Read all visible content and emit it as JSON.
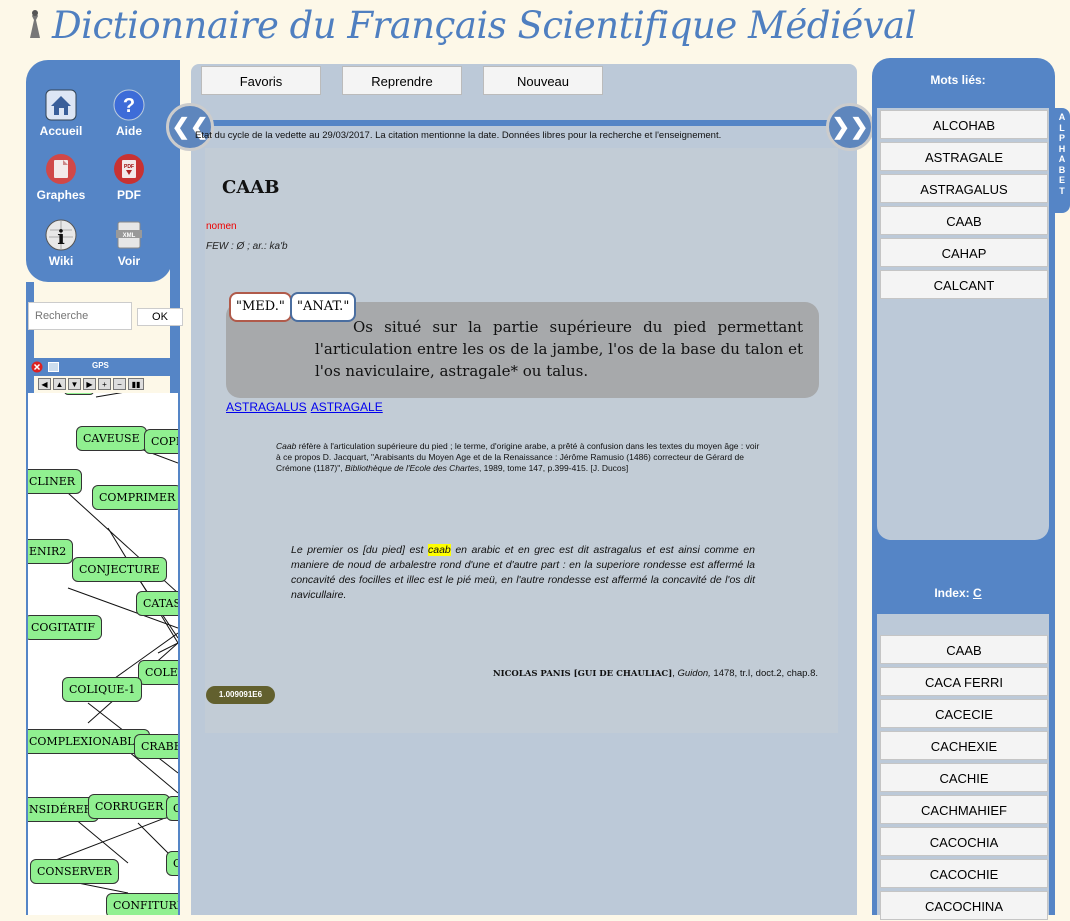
{
  "site": {
    "title": "Dictionnaire du Français Scientifique Médiéval"
  },
  "menu": [
    {
      "label": "Accueil",
      "icon": "home-icon"
    },
    {
      "label": "Aide",
      "icon": "help-icon"
    },
    {
      "label": "Graphes",
      "icon": "graph-icon"
    },
    {
      "label": "PDF",
      "icon": "pdf-icon"
    },
    {
      "label": "Wiki",
      "icon": "wiki-icon"
    },
    {
      "label": "Voir",
      "icon": "xml-icon"
    }
  ],
  "search": {
    "placeholder": "Recherche",
    "ok_label": "OK"
  },
  "gps": {
    "title": "GPS",
    "nodes": [
      "CAVEUSE",
      "COPIE",
      "CLINER",
      "COMPRIMER",
      "ENIR2",
      "CONJECTURE",
      "CATAST",
      "COGITATIF",
      "COLET",
      "COLIQUE-1",
      "COMPLEXIONABLE",
      "CRABE",
      "NSIDÉRER",
      "CORRUGER",
      "C",
      "CONSERVER",
      "C",
      "CONFITURE"
    ]
  },
  "toolbar": {
    "favoris": "Favoris",
    "reprendre": "Reprendre",
    "nouveau": "Nouveau"
  },
  "entry": {
    "status": "Etat du cycle de la vedette au 29/03/2017. La citation mentionne la date. Données libres pour la recherche et l'enseignement.",
    "headword": "CAAB",
    "pos": "nomen",
    "few": "FEW : Ø ; ar.: ka'b",
    "tags": [
      "\"MED.\"",
      "\"ANAT.\""
    ],
    "definition": "Os situé sur la partie supérieure du pied permettant l'articulation entre les os de la jambe, l'os de la base du talon et l'os naviculaire, astragale* ou talus.",
    "links": [
      "ASTRAGALUS",
      "ASTRAGALE"
    ],
    "note_word": "Caab",
    "note_text": " réfère à l'articulation supérieure du pied ; le terme, d'origine arabe, a prêté à confusion dans les textes du moyen âge : voir à ce propos D. Jacquart, \"Arabisants du Moyen Age et de la Renaissance : Jérôme Ramusio (1486) correcteur de Gérard de Crémone (1187)\", ",
    "note_journal": "Bibliothèque de l'Ecole des Chartes",
    "note_end": ", 1989, tome 147, p.399-415. [J. Ducos]",
    "citation_before": "Le premier os [du pied] est ",
    "citation_highlight": "caab",
    "citation_after": " en arabic et en grec est dit astragalus et est ainsi comme en maniere de noud de arbalestre rond d'une et d'autre part : en la superiore rondesse est affermé la concavité des focilles et illec est le pié meü, en l'autre rondesse est affermé la concavité de l'os dit navicullaire.",
    "source_author": "NICOLAS PANIS [GUI DE CHAULIAC]",
    "source_work": "Guidon,",
    "source_ref": " 1478, tr.I, doct.2, chap.8.",
    "version": "1.009091E6"
  },
  "mots_lies": {
    "title": "Mots liés:",
    "items": [
      "ALCOHAB",
      "ASTRAGALE",
      "ASTRAGALUS",
      "CAAB",
      "CAHAP",
      "CALCANT"
    ]
  },
  "alphabet_tab": "ALPHABET",
  "index": {
    "label": "Index:",
    "letter": "C",
    "items": [
      "CAAB",
      "CACA FERRI",
      "CACECIE",
      "CACHEXIE",
      "CACHIE",
      "CACHMAHIEF",
      "CACOCHIA",
      "CACOCHIE",
      "CACOCHINA"
    ]
  },
  "colors": {
    "accent": "#5585c6",
    "panel": "#bcc9d8",
    "node": "#90f090"
  }
}
